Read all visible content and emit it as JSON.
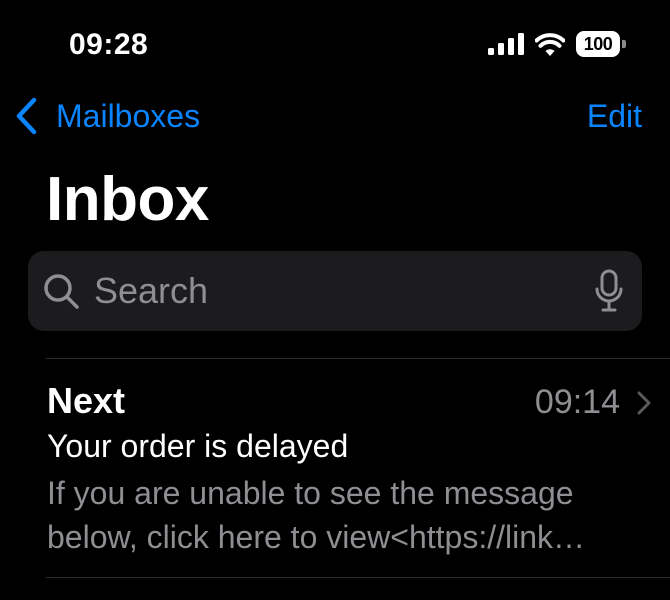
{
  "status_bar": {
    "time": "09:28",
    "battery_level": "100",
    "signal_bars": 4,
    "icons": [
      "cellular-signal-icon",
      "wifi-icon",
      "battery-icon"
    ]
  },
  "nav": {
    "back_label": "Mailboxes",
    "edit_label": "Edit",
    "back_icon": "chevron-left-icon"
  },
  "page": {
    "title": "Inbox"
  },
  "search": {
    "placeholder": "Search",
    "value": "",
    "icons": [
      "search-icon",
      "microphone-icon"
    ]
  },
  "messages": [
    {
      "sender": "Next",
      "time": "09:14",
      "subject": "Your order is delayed",
      "preview": "If you are unable to see the message\nbelow, click here to view<https://link…"
    }
  ],
  "colors": {
    "background": "#000000",
    "accent": "#0a84ff",
    "secondary_text": "#8e8e93",
    "search_field": "#1c1c1e",
    "separator": "#2c2c2e"
  }
}
